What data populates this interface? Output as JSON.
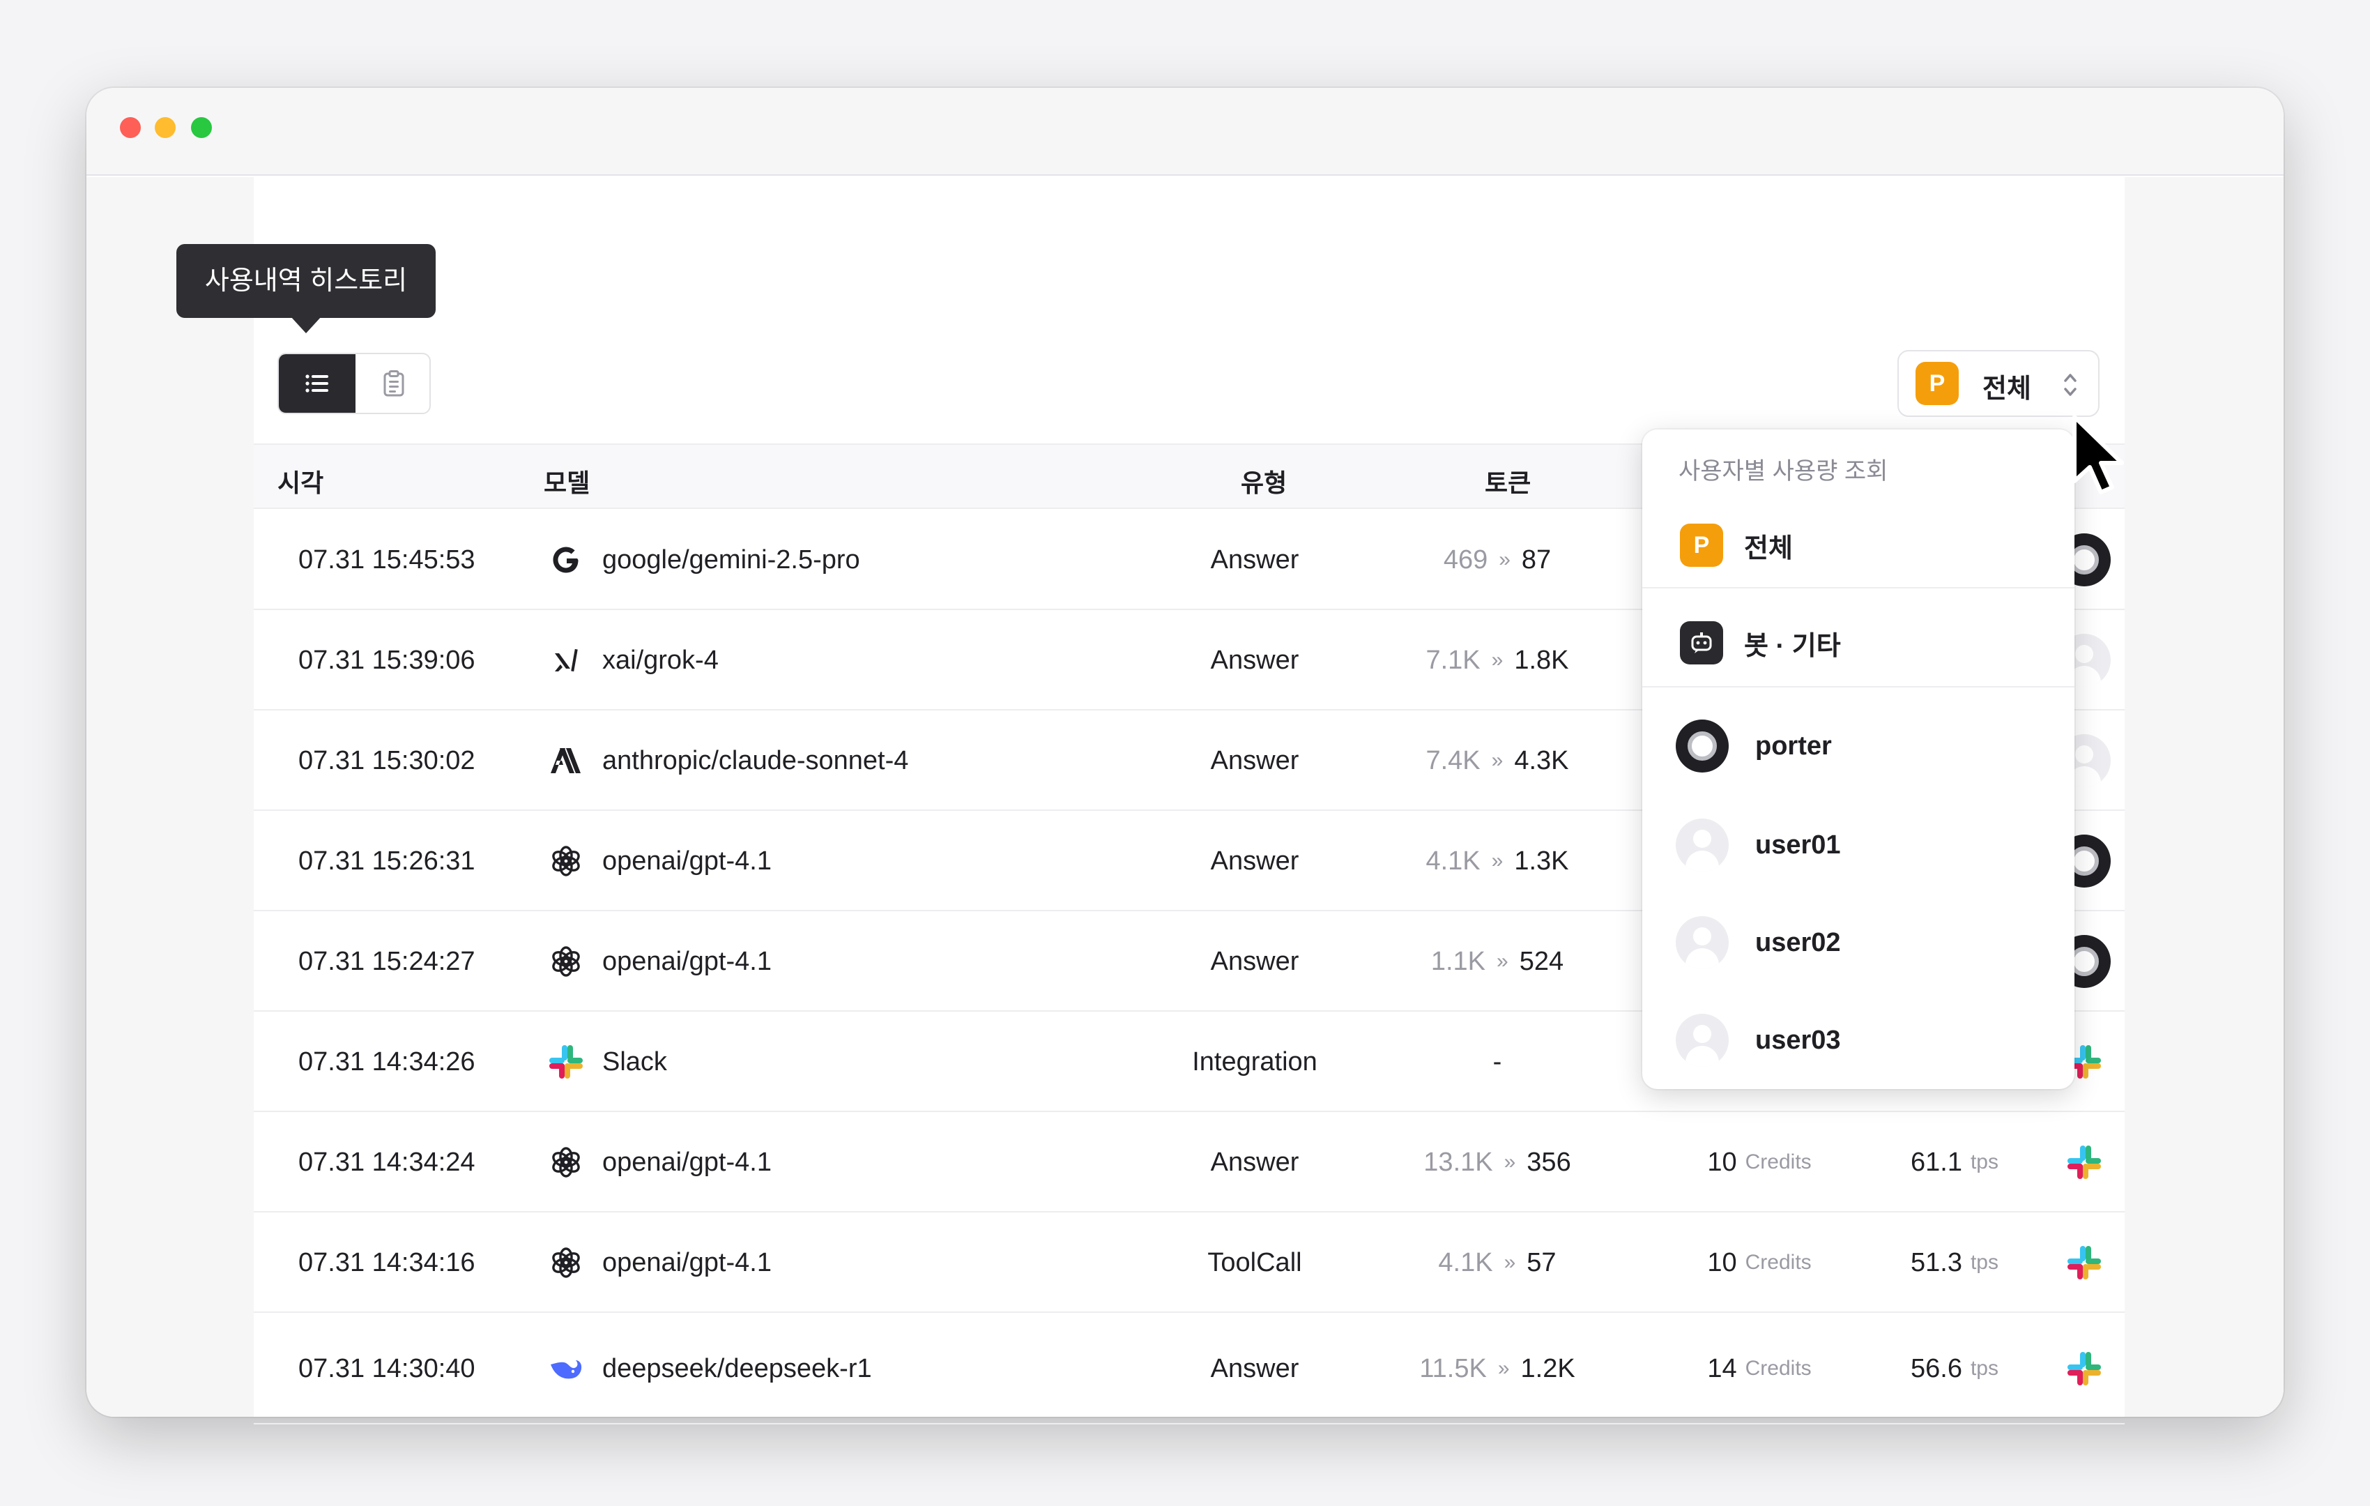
{
  "tooltip": "사용내역 히스토리",
  "user_select": {
    "badge": "P",
    "label": "전체"
  },
  "columns": {
    "time": "시각",
    "model": "모델",
    "type": "유형",
    "tokens": "토큰"
  },
  "rows": [
    {
      "time": "07.31 15:45:53",
      "icon": "google-icon",
      "model": "google/gemini-2.5-pro",
      "type": "Answer",
      "tok_in": "469",
      "tok_out": "87",
      "credits": "",
      "tps": "",
      "source": "porter-avatar"
    },
    {
      "time": "07.31 15:39:06",
      "icon": "xai-icon",
      "model": "xai/grok-4",
      "type": "Answer",
      "tok_in": "7.1K",
      "tok_out": "1.8K",
      "credits": "",
      "tps": "",
      "source": "user-avatar"
    },
    {
      "time": "07.31 15:30:02",
      "icon": "anthropic-icon",
      "model": "anthropic/claude-sonnet-4",
      "type": "Answer",
      "tok_in": "7.4K",
      "tok_out": "4.3K",
      "credits": "",
      "tps": "",
      "source": "user-avatar"
    },
    {
      "time": "07.31 15:26:31",
      "icon": "openai-icon",
      "model": "openai/gpt-4.1",
      "type": "Answer",
      "tok_in": "4.1K",
      "tok_out": "1.3K",
      "credits": "",
      "tps": "",
      "source": "porter-avatar"
    },
    {
      "time": "07.31 15:24:27",
      "icon": "openai-icon",
      "model": "openai/gpt-4.1",
      "type": "Answer",
      "tok_in": "1.1K",
      "tok_out": "524",
      "credits": "",
      "tps": "",
      "source": "porter-avatar"
    },
    {
      "time": "07.31 14:34:26",
      "icon": "slack-icon",
      "model": "Slack",
      "type": "Integration",
      "tok_in": "",
      "tok_out": "-",
      "credits": "",
      "tps": "",
      "source": "slack-icon"
    },
    {
      "time": "07.31 14:34:24",
      "icon": "openai-icon",
      "model": "openai/gpt-4.1",
      "type": "Answer",
      "tok_in": "13.1K",
      "tok_out": "356",
      "credits": "10",
      "tps": "61.1",
      "source": "slack-icon"
    },
    {
      "time": "07.31 14:34:16",
      "icon": "openai-icon",
      "model": "openai/gpt-4.1",
      "type": "ToolCall",
      "tok_in": "4.1K",
      "tok_out": "57",
      "credits": "10",
      "tps": "51.3",
      "source": "slack-icon"
    },
    {
      "time": "07.31 14:30:40",
      "icon": "deepseek-icon",
      "model": "deepseek/deepseek-r1",
      "type": "Answer",
      "tok_in": "11.5K",
      "tok_out": "1.2K",
      "credits": "14",
      "tps": "56.6",
      "source": "slack-icon"
    }
  ],
  "units": {
    "credits": "Credits",
    "tps": "tps",
    "arrow": "»"
  },
  "dropdown": {
    "header": "사용자별 사용량 조회",
    "items": [
      {
        "label": "전체",
        "badge": "P"
      },
      {
        "label": "봇 · 기타"
      },
      {
        "label": "porter"
      },
      {
        "label": "user01"
      },
      {
        "label": "user02"
      },
      {
        "label": "user03"
      }
    ]
  },
  "colors": {
    "accent": "#f59e0b",
    "dark": "#2a2a2e",
    "muted": "#9a9aa3"
  }
}
